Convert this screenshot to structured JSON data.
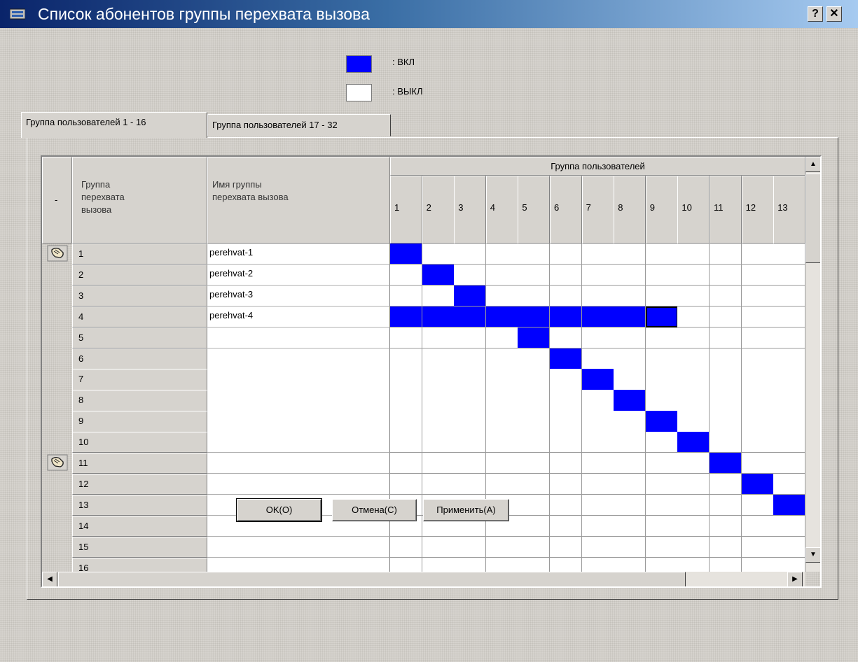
{
  "window": {
    "title": "Список абонентов группы перехвата вызова",
    "help_label": "?",
    "close_label": "✕"
  },
  "legend": {
    "on_label": ": ВКЛ",
    "off_label": ": ВЫКЛ",
    "on_color": "#0000ff",
    "off_color": "#ffffff"
  },
  "tabs": [
    {
      "label": "Группа пользователей 1 - 16",
      "active": true
    },
    {
      "label": "Группа пользователей 17 - 32",
      "active": false
    }
  ],
  "table": {
    "marker_header": "-",
    "group_header": "Группа перехвата вызова",
    "name_header": "Имя группы перехвата вызова",
    "users_header": "Группа пользователей",
    "user_columns": [
      "1",
      "2",
      "3",
      "4",
      "5",
      "6",
      "7",
      "8",
      "9",
      "10",
      "11",
      "12",
      "13"
    ],
    "rows": [
      {
        "num": "1",
        "name": "perehvat-1",
        "marker": true,
        "on": [
          1
        ]
      },
      {
        "num": "2",
        "name": "perehvat-2",
        "marker": false,
        "on": [
          2
        ]
      },
      {
        "num": "3",
        "name": "perehvat-3",
        "marker": false,
        "on": [
          3
        ]
      },
      {
        "num": "4",
        "name": "perehvat-4",
        "marker": false,
        "on": [
          1,
          2,
          3,
          4,
          5,
          6,
          7,
          8,
          9
        ],
        "selected_col": 9
      },
      {
        "num": "5",
        "name": "",
        "marker": false,
        "on": [
          5
        ]
      },
      {
        "num": "6",
        "name": "",
        "marker": false,
        "on": [
          6
        ]
      },
      {
        "num": "7",
        "name": "",
        "marker": false,
        "on": [
          7
        ]
      },
      {
        "num": "8",
        "name": "",
        "marker": false,
        "on": [
          8
        ]
      },
      {
        "num": "9",
        "name": "",
        "marker": false,
        "on": [
          9
        ]
      },
      {
        "num": "10",
        "name": "",
        "marker": false,
        "on": [
          10
        ]
      },
      {
        "num": "11",
        "name": "",
        "marker": true,
        "on": [
          11
        ]
      },
      {
        "num": "12",
        "name": "",
        "marker": false,
        "on": [
          12
        ]
      },
      {
        "num": "13",
        "name": "",
        "marker": false,
        "on": [
          13
        ]
      },
      {
        "num": "14",
        "name": "",
        "marker": false,
        "on": []
      },
      {
        "num": "15",
        "name": "",
        "marker": false,
        "on": []
      },
      {
        "num": "16",
        "name": "",
        "marker": false,
        "on": []
      }
    ],
    "marker_icon": "hand-pointer-icon"
  },
  "buttons": {
    "ok": "OK(O)",
    "cancel": "Отмена(C)",
    "apply": "Применить(A)"
  }
}
